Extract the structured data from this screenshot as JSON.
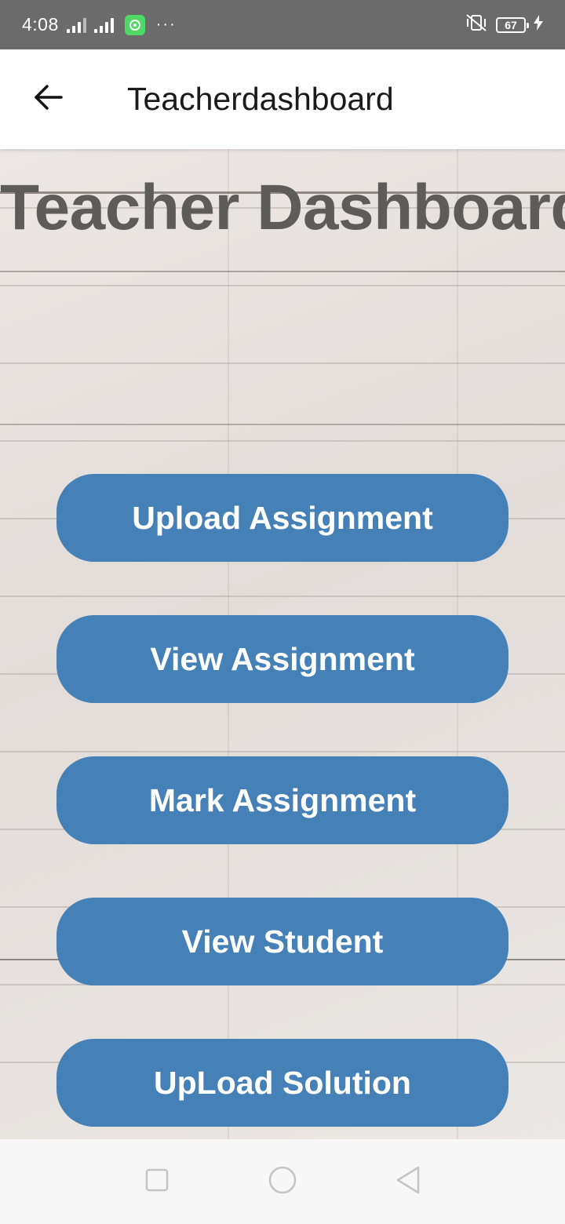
{
  "status_bar": {
    "time": "4:08",
    "battery_level": "67",
    "icons": [
      "signal-icon",
      "signal-icon",
      "chat-app-icon",
      "more-dots-icon",
      "vibrate-icon",
      "battery-icon",
      "charging-icon"
    ]
  },
  "app_bar": {
    "title": "Teacherdashboard",
    "back_icon": "arrow-left-icon"
  },
  "main": {
    "heading": "Teacher Dashboard",
    "buttons": [
      {
        "label": "Upload Assignment"
      },
      {
        "label": "View Assignment"
      },
      {
        "label": "Mark Assignment"
      },
      {
        "label": "View Student"
      },
      {
        "label": "UpLoad Solution"
      }
    ],
    "button_color": "#4580b7",
    "heading_color": "#5e5b5b"
  },
  "nav_bar": {
    "icons": [
      "recents-square-icon",
      "home-circle-icon",
      "back-triangle-icon"
    ]
  }
}
